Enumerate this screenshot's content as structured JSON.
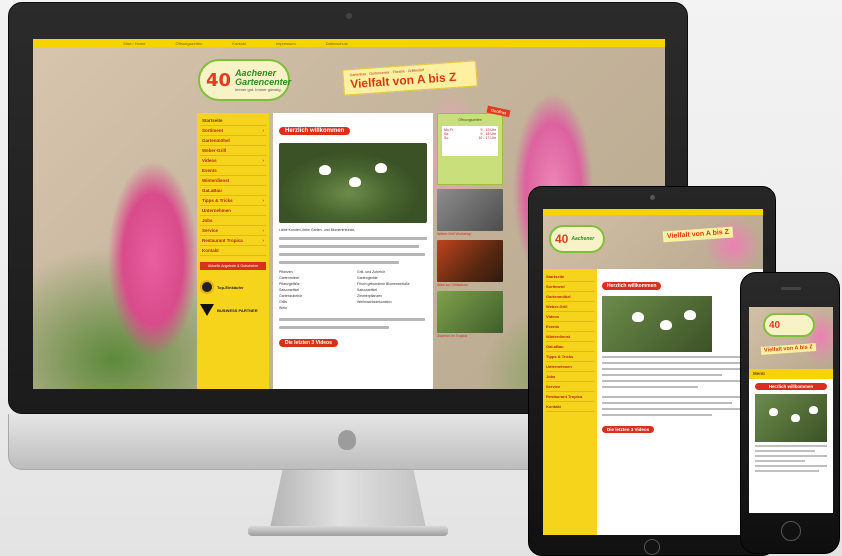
{
  "site": {
    "logo": {
      "number": "40",
      "line1": "Aachener",
      "line2": "Gartencenter",
      "tagline": "Immer gut. Immer günstig."
    },
    "slogan_small": "Gartenbau · Gartencenter · Floristik · Grillbedarf",
    "slogan_big": "Vielfalt von A bis Z",
    "topbar": [
      "Start / Home",
      "Öffnungszeiten",
      "Kontakt",
      "Impressum",
      "Datenschutz"
    ],
    "nav": [
      {
        "label": "Startseite",
        "arrow": ""
      },
      {
        "label": "Sortiment",
        "arrow": "›"
      },
      {
        "label": "Gartenmöbel",
        "arrow": ""
      },
      {
        "label": "Weber-Grill",
        "arrow": ""
      },
      {
        "label": "Videos",
        "arrow": "›"
      },
      {
        "label": "Events",
        "arrow": ""
      },
      {
        "label": "Winterdienst",
        "arrow": ""
      },
      {
        "label": "GaLaBau",
        "arrow": ""
      },
      {
        "label": "Tipps & Tricks",
        "arrow": "›"
      },
      {
        "label": "Unternehmen",
        "arrow": ""
      },
      {
        "label": "Jobs",
        "arrow": ""
      },
      {
        "label": "Service",
        "arrow": "›"
      },
      {
        "label": "Restaurant Tropica",
        "arrow": "›"
      },
      {
        "label": "Kontakt",
        "arrow": ""
      }
    ],
    "promo": "Aktuelle Angebote & Gutscheine",
    "partner1": "Top-Einkäufer",
    "partner2": "BUSINESS PARTNER",
    "welcome": "Herzlich willkommen",
    "intro": "Liebe Kunden, liebe Garten- und Blumenfreunde,",
    "bullets": [
      "Pflanzen",
      "Gartenmöbel",
      "Pflanzgefäße",
      "Saisonartikel",
      "Gartenzubehör",
      "Grill- und Zubehör",
      "Gartengeräte",
      "Frisch gebundene Blumensträuße",
      "Saisonartikel",
      "Zimmerpflanzen",
      "Grills",
      "Weihnachtsdekoration",
      "Wein"
    ],
    "last_videos": "Die letzten 3 Videos",
    "hours": {
      "title": "Öffnungszeiten",
      "rows": [
        {
          "day": "Mo-Fr",
          "time": "9 - 19 Uhr"
        },
        {
          "day": "Sa",
          "time": "9 - 18 Uhr"
        },
        {
          "day": "So",
          "time": "10 - 17 Uhr"
        }
      ],
      "badge": "Geöffnet"
    },
    "thumbs": [
      {
        "caption": "Weber-Grill Workshop"
      },
      {
        "caption": "Alles zur Grillsaison"
      },
      {
        "caption": "Zubehör im Tropica"
      }
    ]
  },
  "ipad": {
    "logo_number": "40",
    "logo_name": "Aachener",
    "slogan": "Vielfalt von A bis Z",
    "nav": [
      "Startseite",
      "Sortiment",
      "Gartenmöbel",
      "Weber-Grill",
      "Videos",
      "Events",
      "Winterdienst",
      "GaLaBau",
      "Tipps & Tricks",
      "Unternehmen",
      "Jobs",
      "Service",
      "Restaurant Tropica",
      "Kontakt"
    ],
    "welcome": "Herzlich willkommen",
    "last_videos": "Die letzten 3 Videos"
  },
  "iphone": {
    "logo_number": "40",
    "slogan": "Vielfalt von A bis Z",
    "menu": "Menü",
    "welcome": "Herzlich willkommen"
  }
}
